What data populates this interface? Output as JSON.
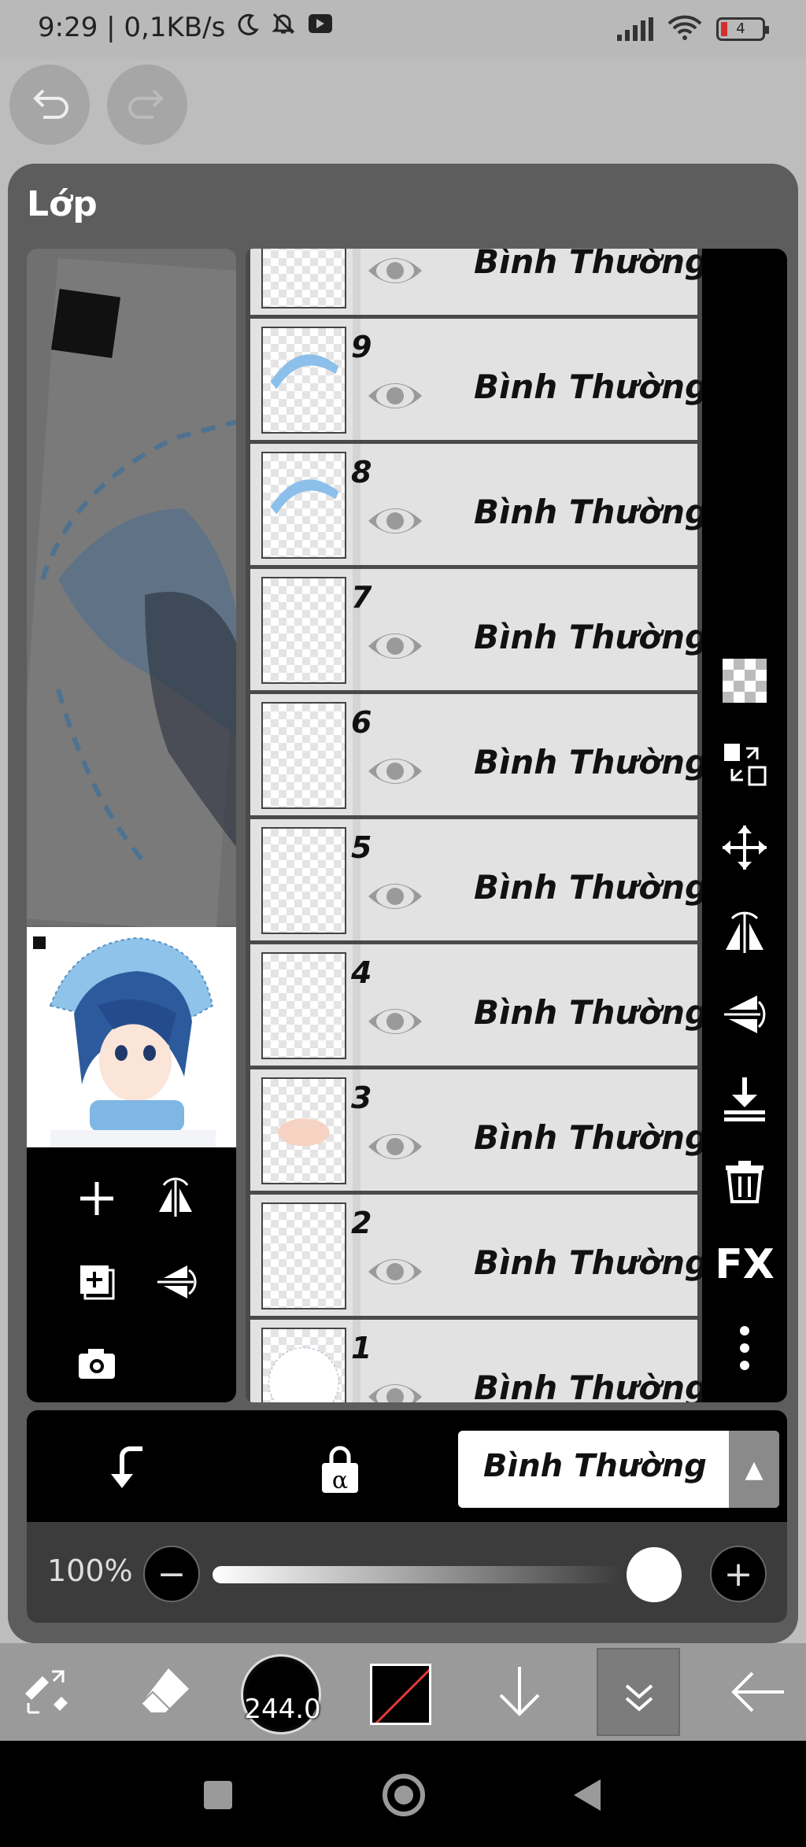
{
  "status_bar": {
    "time_speed": "9:29 | 0,1KB/s",
    "battery": "4",
    "battery_color": "#d32f2f"
  },
  "top_controls": {
    "undo_icon": "undo-icon",
    "redo_icon": "redo-icon"
  },
  "panel": {
    "title": "Lớp"
  },
  "layers": [
    {
      "number": "",
      "blend_mode": "Bình Thường",
      "visible": true
    },
    {
      "number": "9",
      "blend_mode": "Bình Thường",
      "visible": true
    },
    {
      "number": "8",
      "blend_mode": "Bình Thường",
      "visible": true
    },
    {
      "number": "7",
      "blend_mode": "Bình Thường",
      "visible": true
    },
    {
      "number": "6",
      "blend_mode": "Bình Thường",
      "visible": true
    },
    {
      "number": "5",
      "blend_mode": "Bình Thường",
      "visible": true
    },
    {
      "number": "4",
      "blend_mode": "Bình Thường",
      "visible": true
    },
    {
      "number": "3",
      "blend_mode": "Bình Thường",
      "visible": true
    },
    {
      "number": "2",
      "blend_mode": "Bình Thường",
      "visible": true
    },
    {
      "number": "1",
      "blend_mode": "Bình Thường",
      "visible": true
    }
  ],
  "right_toolbar": {
    "fx_label": "FX"
  },
  "blend_bar": {
    "selected_blend": "Bình Thường",
    "dropdown_arrow": "▲"
  },
  "opacity": {
    "label": "100%",
    "value": 1.0,
    "minus": "−",
    "plus": "+"
  },
  "bottom_toolbar": {
    "brush_size": "244.0",
    "primary_color": "#000000"
  }
}
